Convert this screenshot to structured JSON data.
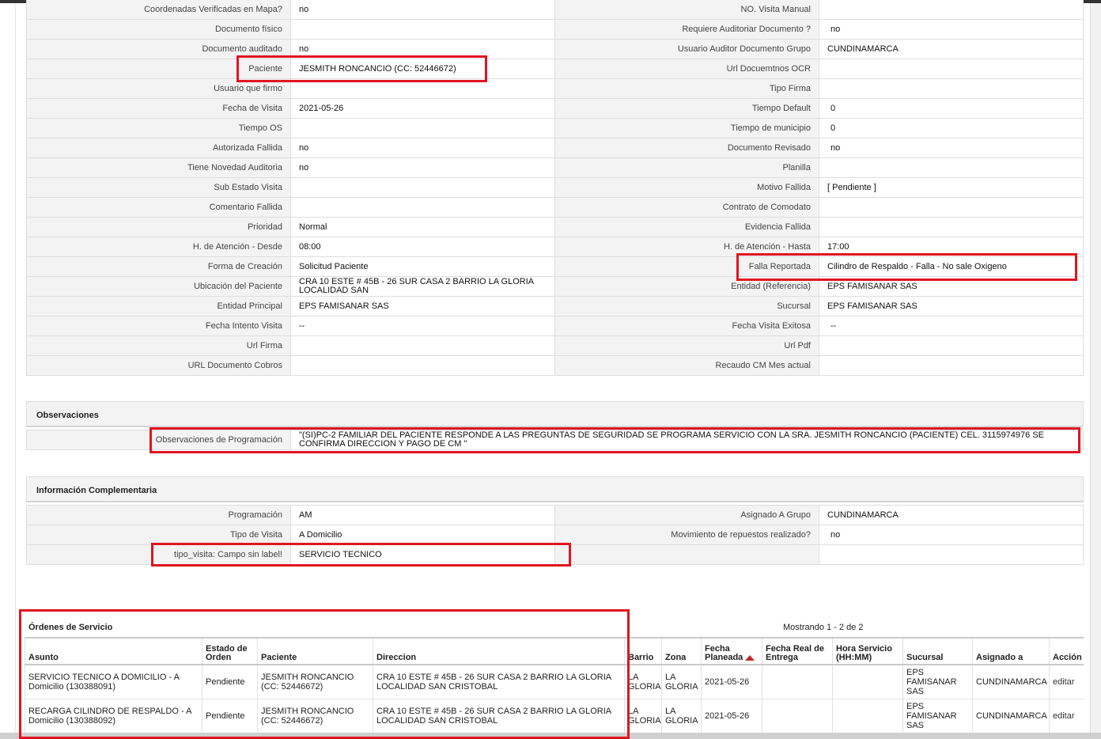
{
  "details": [
    [
      "Coordenadas Verificadas en Mapa?",
      "no",
      "NO. Visita Manual",
      ""
    ],
    [
      "Documento físico",
      "",
      "Requiere Auditoriar Documento ?",
      "no"
    ],
    [
      "Documento auditado",
      "no",
      "Usuario Auditor Documento Grupo",
      "CUNDINAMARCA"
    ],
    [
      "Paciente",
      "JESMITH RONCANCIO (CC: 52446672)",
      "Url Docuemtnos OCR",
      ""
    ],
    [
      "Usuario que firmo",
      "",
      "Tipo Firma",
      ""
    ],
    [
      "Fecha de Visita",
      "2021-05-26",
      "Tiempo Default",
      "0"
    ],
    [
      "Tiempo OS",
      "",
      "Tiempo de municipio",
      "0"
    ],
    [
      "Autorizada Fallida",
      "no",
      "Documento Revisado",
      "no"
    ],
    [
      "Tiene Novedad Auditoria",
      "no",
      "Planilla",
      ""
    ],
    [
      "Sub Estado Visita",
      "",
      "Motivo Fallida",
      "[ Pendiente ]"
    ],
    [
      "Comentario Fallida",
      "",
      "Contrato de Comodato",
      ""
    ],
    [
      "Prioridad",
      "Normal",
      "Evidencia Fallida",
      ""
    ],
    [
      "H. de Atención - Desde",
      "08:00",
      "H. de Atención - Hasta",
      "17:00"
    ],
    [
      "Forma de Creación",
      "Solicitud Paciente",
      "Falla Reportada",
      "Cilindro de Respaldo - Falla - No sale Oxigeno"
    ],
    [
      "Ubicación del Paciente",
      "CRA 10 ESTE # 45B - 26 SUR CASA 2 BARRIO LA GLORIA LOCALIDAD SAN",
      "Entidad (Referencia)",
      "EPS FAMISANAR SAS"
    ],
    [
      "Entidad Principal",
      "EPS FAMISANAR SAS",
      "Sucursal",
      "EPS FAMISANAR SAS"
    ],
    [
      "Fecha Intento Visita",
      "--",
      "Fecha Visita Exitosa",
      "--"
    ],
    [
      "Url Firma",
      "",
      "Url Pdf",
      ""
    ],
    [
      "URL Documento Cobros",
      "",
      "Recaudo CM Mes actual",
      ""
    ]
  ],
  "observaciones": {
    "title": "Observaciones",
    "label": "Observaciones de Programación",
    "value": "\"(SI)PC-2 FAMILIAR DEL PACIENTE RESPONDE A LAS PREGUNTAS DE SEGURIDAD SE PROGRAMA SERVICIO CON LA SRA. JESMITH RONCANCIO (PACIENTE) CEL. 3115974976 SE CONFIRMA DIRECCION Y PAGO DE CM \""
  },
  "complementaria": {
    "title": "Información Complementaria",
    "rows": [
      [
        "Programación",
        "AM",
        "Asignado A Grupo",
        "CUNDINAMARCA"
      ],
      [
        "Tipo de Visita",
        "A Domicilio",
        "Movimiento de repuestos realizado?",
        "no"
      ],
      [
        "tipo_visita: Campo sin label!",
        "SERVICIO TECNICO",
        "",
        ""
      ]
    ]
  },
  "ordenes": {
    "title": "Órdenes de Servicio",
    "count_text": "Mostrando 1 - 2 de 2",
    "columns": [
      "Asunto",
      "Estado de Orden",
      "Paciente",
      "Direccion",
      "Barrio",
      "Zona",
      "Fecha Planeada",
      "Fecha Real de Entrega",
      "Hora Servicio (HH:MM)",
      "Sucursal",
      "Asignado a",
      "Acción"
    ],
    "rows": [
      [
        "SERVICIO TECNICO A DOMICILIO - A Domicilio (130388091)",
        "Pendiente",
        "JESMITH RONCANCIO (CC: 52446672)",
        "CRA 10 ESTE # 45B - 26 SUR CASA 2 BARRIO LA GLORIA LOCALIDAD SAN CRISTOBAL",
        "LA GLORIA",
        "LA GLORIA",
        "2021-05-26",
        "",
        "",
        "EPS FAMISANAR SAS",
        "CUNDINAMARCA",
        "editar"
      ],
      [
        "RECARGA CILINDRO DE RESPALDO - A Domicilio (130388092)",
        "Pendiente",
        "JESMITH RONCANCIO (CC: 52446672)",
        "CRA 10 ESTE # 45B - 26 SUR CASA 2 BARRIO LA GLORIA LOCALIDAD SAN CRISTOBAL",
        "LA GLORIA",
        "LA GLORIA",
        "2021-05-26",
        "",
        "",
        "EPS FAMISANAR SAS",
        "CUNDINAMARCA",
        "editar"
      ]
    ]
  },
  "colors": {
    "highlight": "#e01520",
    "label_bg": "#f3f3f3",
    "border": "#dedede"
  },
  "icons": {
    "sort": "sort-asc-icon"
  }
}
